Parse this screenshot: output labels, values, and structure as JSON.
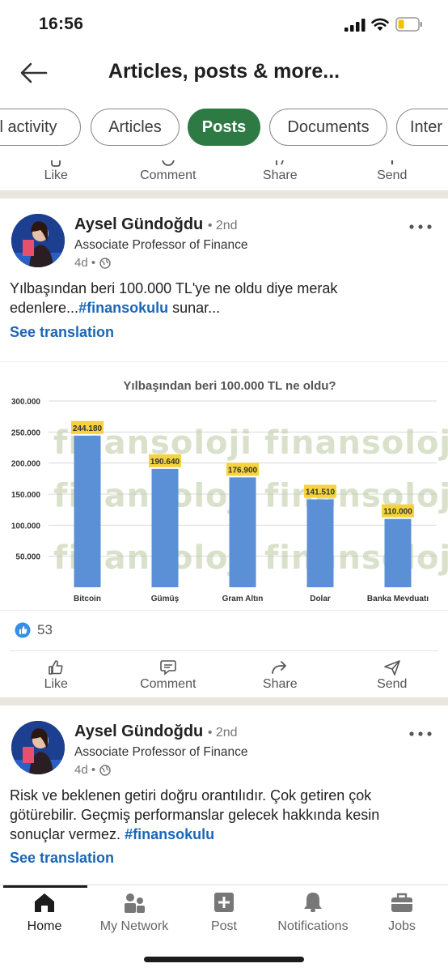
{
  "status_bar": {
    "time": "16:56"
  },
  "header": {
    "title": "Articles, posts & more..."
  },
  "filters": [
    {
      "label": "l activity",
      "active": false
    },
    {
      "label": "Articles",
      "active": false
    },
    {
      "label": "Posts",
      "active": true
    },
    {
      "label": "Documents",
      "active": false
    },
    {
      "label": "Inter",
      "active": false
    }
  ],
  "actions": {
    "like": "Like",
    "comment": "Comment",
    "share": "Share",
    "send": "Send"
  },
  "post1": {
    "author": "Aysel Gündoğdu",
    "degree": "• 2nd",
    "headline": "Associate Professor of Finance",
    "time": "4d •",
    "text_line1": "Yılbaşından beri 100.000 TL'ye ne oldu diye merak",
    "text_line2_pre": "edenlere...",
    "hashtag": "#finansokulu",
    "text_line2_post": " sunar...",
    "see_translation": "See translation",
    "reaction_count": "53"
  },
  "chart_data": {
    "type": "bar",
    "title": "Yılbaşından beri 100.000 TL ne oldu?",
    "categories": [
      "Bitcoin",
      "Gümüş",
      "Gram Altın",
      "Dolar",
      "Banka Mevduatı"
    ],
    "values": [
      244180,
      190640,
      176900,
      141510,
      110000
    ],
    "value_labels": [
      "244.180",
      "190.640",
      "176.900",
      "141.510",
      "110.000"
    ],
    "ylim": [
      0,
      300000
    ],
    "yticks": [
      "300.000",
      "250.000",
      "200.000",
      "150.000",
      "100.000",
      "50.000"
    ],
    "watermark": "finansoloji finansoloj",
    "bar_color": "#5b8fd6",
    "label_color": "#f5d33c",
    "grid": true
  },
  "post2": {
    "author": "Aysel Gündoğdu",
    "degree": "• 2nd",
    "headline": "Associate Professor of Finance",
    "time": "4d •",
    "line1": "Risk ve beklenen getiri doğru orantılıdır. Çok getiren çok",
    "line2": "götürebilir. Geçmiş performanslar gelecek hakkında kesin",
    "line3_pre": "sonuçlar vermez. ",
    "hashtag": "#finansokulu",
    "see_translation": "See translation"
  },
  "bottom_nav": {
    "home": "Home",
    "network": "My Network",
    "post": "Post",
    "notifications": "Notifications",
    "jobs": "Jobs"
  },
  "colors": {
    "accent": "#2e7a45",
    "link": "#1a66b8"
  }
}
